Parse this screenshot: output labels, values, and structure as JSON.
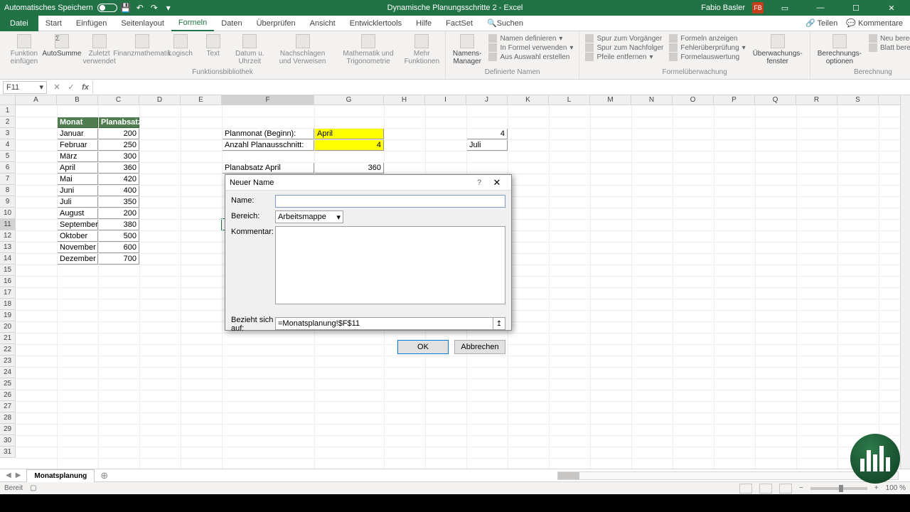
{
  "titlebar": {
    "autosave": "Automatisches Speichern",
    "doc_title": "Dynamische Planungsschritte 2 - Excel",
    "user": "Fabio Basler",
    "user_initials": "FB"
  },
  "tabs": {
    "file": "Datei",
    "items": [
      "Start",
      "Einfügen",
      "Seitenlayout",
      "Formeln",
      "Daten",
      "Überprüfen",
      "Ansicht",
      "Entwicklertools",
      "Hilfe",
      "FactSet"
    ],
    "active": "Formeln",
    "search": "Suchen",
    "share": "Teilen",
    "comments": "Kommentare"
  },
  "ribbon": {
    "groups": {
      "funcLib": "Funktionsbibliothek",
      "definedNames": "Definierte Namen",
      "formulaAudit": "Formelüberwachung",
      "calculation": "Berechnung"
    },
    "btns": {
      "insertFn": "Funktion einfügen",
      "autosum": "AutoSumme",
      "recent": "Zuletzt verwendet",
      "financial": "Finanzmathematik",
      "logical": "Logisch",
      "text": "Text",
      "datetime": "Datum u. Uhrzeit",
      "lookup": "Nachschlagen und Verweisen",
      "mathtrig": "Mathematik und Trigonometrie",
      "more": "Mehr Funktionen",
      "nameMgr": "Namens-Manager",
      "defineName": "Namen definieren",
      "useInFormula": "In Formel verwenden",
      "createFromSel": "Aus Auswahl erstellen",
      "tracePrec": "Spur zum Vorgänger",
      "traceDep": "Spur zum Nachfolger",
      "removeArrows": "Pfeile entfernen",
      "showFormulas": "Formeln anzeigen",
      "errorCheck": "Fehlerüberprüfung",
      "evalFormula": "Formelauswertung",
      "watchWin": "Überwachungs-fenster",
      "calcOpts": "Berechnungs-optionen",
      "calcNow": "Neu berechnen",
      "calcSheet": "Blatt berechnen"
    }
  },
  "namebox": "F11",
  "columns": [
    "A",
    "B",
    "C",
    "D",
    "E",
    "F",
    "G",
    "H",
    "I",
    "J",
    "K",
    "L",
    "M",
    "N",
    "O",
    "P",
    "Q",
    "R",
    "S"
  ],
  "sheetData": {
    "headers": {
      "month": "Monat",
      "plan": "Planabsatz"
    },
    "rows": [
      {
        "m": "Januar",
        "v": "200"
      },
      {
        "m": "Februar",
        "v": "250"
      },
      {
        "m": "März",
        "v": "300"
      },
      {
        "m": "April",
        "v": "360"
      },
      {
        "m": "Mai",
        "v": "420"
      },
      {
        "m": "Juni",
        "v": "400"
      },
      {
        "m": "Juli",
        "v": "350"
      },
      {
        "m": "August",
        "v": "200"
      },
      {
        "m": "September",
        "v": "380"
      },
      {
        "m": "Oktober",
        "v": "500"
      },
      {
        "m": "November",
        "v": "600"
      },
      {
        "m": "Dezember",
        "v": "700"
      }
    ],
    "planmonat_label": "Planmonat (Beginn):",
    "planmonat_value": "April",
    "anzahl_label": "Anzahl Planausschnitt:",
    "anzahl_value": "4",
    "aux1": "4",
    "aux2": "Juli",
    "planabsatz_label": "Planabsatz April",
    "planabsatz_value": "360"
  },
  "dialog": {
    "title": "Neuer Name",
    "name_label": "Name:",
    "scope_label": "Bereich:",
    "scope_value": "Arbeitsmappe",
    "comment_label": "Kommentar:",
    "refers_label": "Bezieht sich auf:",
    "refers_value": "=Monatsplanung!$F$11",
    "ok": "OK",
    "cancel": "Abbrechen"
  },
  "sheetTab": "Monatsplanung",
  "status": {
    "ready": "Bereit",
    "zoom": "100 %"
  }
}
